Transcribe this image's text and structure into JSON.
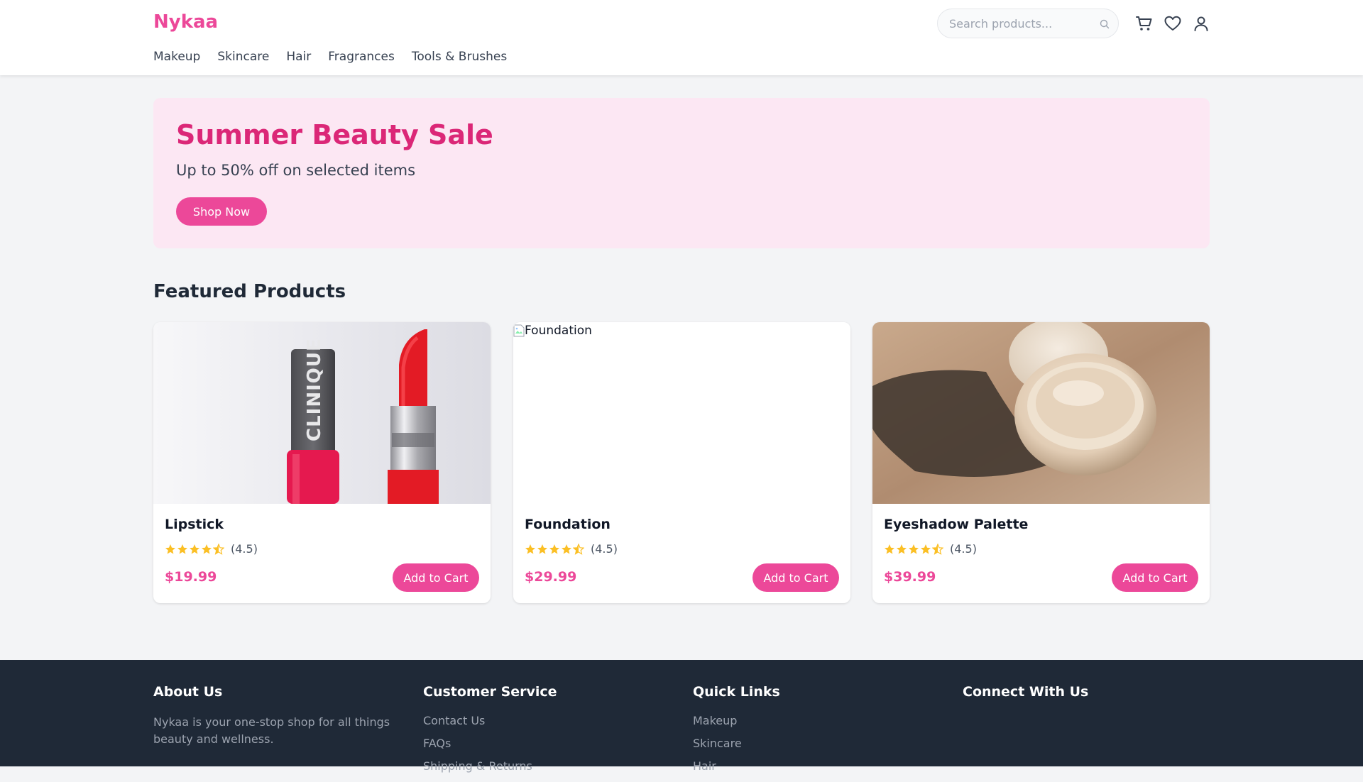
{
  "header": {
    "logo": "Nykaa",
    "nav": [
      "Makeup",
      "Skincare",
      "Hair",
      "Fragrances",
      "Tools & Brushes"
    ],
    "search_placeholder": "Search products...",
    "icons": [
      "search-icon",
      "cart-icon",
      "heart-icon",
      "user-icon"
    ]
  },
  "banner": {
    "title": "Summer Beauty Sale",
    "subtitle": "Up to 50% off on selected items",
    "button": "Shop Now"
  },
  "featured": {
    "title": "Featured Products",
    "products": [
      {
        "name": "Lipstick",
        "rating": 4.5,
        "rating_text": "(4.5)",
        "price": "$19.99",
        "button": "Add to Cart",
        "image_brand_text": "CLINIQUE"
      },
      {
        "name": "Foundation",
        "rating": 4.5,
        "rating_text": "(4.5)",
        "price": "$29.99",
        "button": "Add to Cart",
        "image_alt": "Foundation"
      },
      {
        "name": "Eyeshadow Palette",
        "rating": 4.5,
        "rating_text": "(4.5)",
        "price": "$39.99",
        "button": "Add to Cart"
      }
    ]
  },
  "footer": {
    "about": {
      "title": "About Us",
      "text": "Nykaa is your one-stop shop for all things beauty and wellness."
    },
    "customer_service": {
      "title": "Customer Service",
      "links": [
        "Contact Us",
        "FAQs",
        "Shipping & Returns"
      ]
    },
    "quick_links": {
      "title": "Quick Links",
      "links": [
        "Makeup",
        "Skincare",
        "Hair"
      ]
    },
    "connect": {
      "title": "Connect With Us"
    }
  },
  "colors": {
    "brand_pink": "#ec4899",
    "banner_bg": "#fce7f3",
    "footer_bg": "#1f2937",
    "star": "#fbbf24"
  }
}
